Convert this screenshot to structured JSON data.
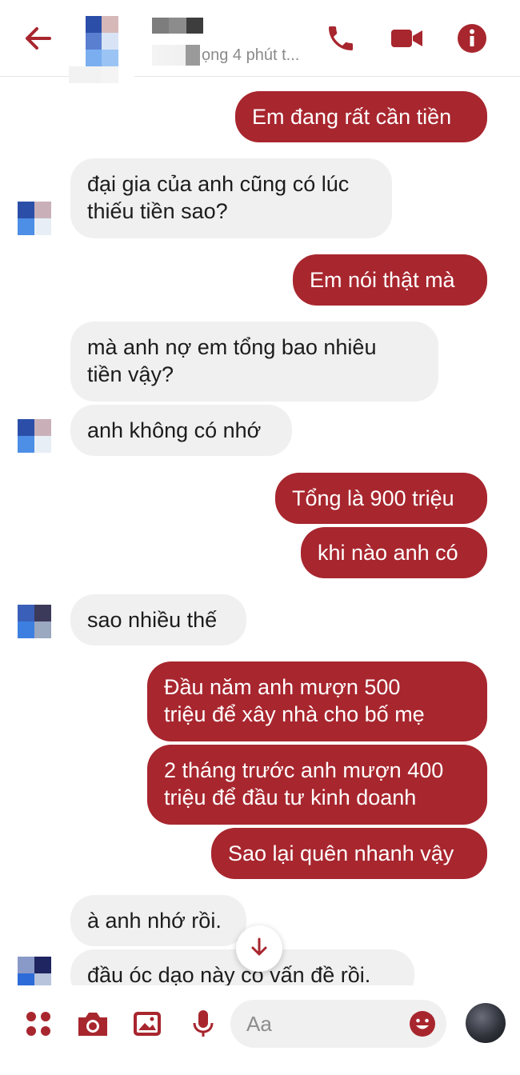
{
  "header": {
    "status_text": "ọng 4 phút t...",
    "accent_color": "#a8262e"
  },
  "messages": [
    {
      "id": "m1",
      "side": "out",
      "text": "Em đang rất cần tiền"
    },
    {
      "id": "m2",
      "side": "in",
      "text": "đại gia của anh cũng có lúc\nthiếu tiền sao?"
    },
    {
      "id": "m3",
      "side": "out",
      "text": "Em nói thật mà"
    },
    {
      "id": "m4",
      "side": "in",
      "text": "mà anh nợ em tổng bao nhiêu\ntiền vậy?"
    },
    {
      "id": "m5",
      "side": "in",
      "text": "anh không có nhớ"
    },
    {
      "id": "m6",
      "side": "out",
      "text": "Tổng là 900 triệu"
    },
    {
      "id": "m7",
      "side": "out",
      "text": "khi nào anh có"
    },
    {
      "id": "m8",
      "side": "in",
      "text": "sao nhiều thế"
    },
    {
      "id": "m9",
      "side": "out",
      "text": "Đầu năm anh mượn 500\ntriệu để xây nhà cho bố mẹ"
    },
    {
      "id": "m10",
      "side": "out",
      "text": "2 tháng trước anh mượn 400\ntriệu để đầu tư kinh doanh"
    },
    {
      "id": "m11",
      "side": "out",
      "text": "Sao lại quên nhanh vậy"
    },
    {
      "id": "m12",
      "side": "in",
      "text": "à anh nhớ rồi."
    },
    {
      "id": "m13",
      "side": "in",
      "text": "đầu óc dạo này có vấn đề rồi."
    }
  ],
  "composer": {
    "placeholder": "Aa",
    "icons": [
      "apps-icon",
      "camera-icon",
      "image-icon",
      "microphone-icon",
      "emoji-icon",
      "like-icon"
    ]
  },
  "icons": {
    "back": "arrow-left-icon",
    "call": "phone-icon",
    "video": "video-camera-icon",
    "info": "info-icon",
    "scroll": "arrow-down-icon"
  }
}
